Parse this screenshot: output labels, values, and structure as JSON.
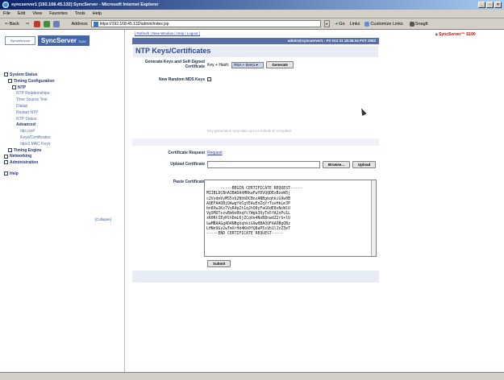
{
  "window": {
    "title": "syncserver1 [192.168.45.132] SyncServer - Microsoft Internet Explorer",
    "minimize": "_",
    "maximize": "▫",
    "close": "×"
  },
  "menubar": [
    "File",
    "Edit",
    "View",
    "Favorites",
    "Tools",
    "Help"
  ],
  "toolbar": {
    "back": "Back",
    "address_label": "Address",
    "address_value": "https://192.168.45.132/admin/index.jsp",
    "go": "Go",
    "links": "Links",
    "customize_links": "Customize Links",
    "snagit": "SnagIt"
  },
  "nav": {
    "logo_company": "Symmetricom",
    "logo_product": "SyncServer",
    "logo_model": "S100",
    "items": [
      {
        "label": "System Status",
        "level": 0,
        "bold": true
      },
      {
        "label": "Timing Configuration",
        "level": 1,
        "bold": true
      },
      {
        "label": "NTP",
        "level": 2,
        "bold": true
      },
      {
        "label": "NTP Relationships",
        "level": 3,
        "bold": false
      },
      {
        "label": "Time Source Test",
        "level": 3,
        "bold": false
      },
      {
        "label": "Dialup",
        "level": 3,
        "bold": false
      },
      {
        "label": "Restart NTP",
        "level": 3,
        "bold": false
      },
      {
        "label": "NTP Status",
        "level": 3,
        "bold": false
      },
      {
        "label": "Advanced",
        "level": 3,
        "bold": true
      },
      {
        "label": "ntp.conf",
        "level": 4,
        "bold": false
      },
      {
        "label": "Keys/Certificates",
        "level": 4,
        "bold": false
      },
      {
        "label": "ntpv3 MAC Keys",
        "level": 4,
        "bold": false
      },
      {
        "label": "Timing Engine",
        "level": 1,
        "bold": true
      },
      {
        "label": "Networking",
        "level": 0,
        "bold": true
      },
      {
        "label": "Administration",
        "level": 0,
        "bold": true
      },
      {
        "label": "Help",
        "level": 0,
        "bold": true
      }
    ],
    "collapse": "[Collapse]"
  },
  "main": {
    "toplinks": "[ Refresh | New Window | Help | Logout ]",
    "brand": "SyncServer™ S100",
    "userbar": "admin@syncserver1 - Fri Oct 31 18:36:34 PST 2003",
    "title": "NTP Keys/Certificates",
    "generate_label": "Generate Keys and Self-Signed Certificate",
    "key_hash_label": "Key + Hash:",
    "key_hash_value": "RSA + SHA1",
    "generate_button": "Generate",
    "new_md5_label": "New Random MD5 Keys",
    "note": "Key generation may take up to a minute to complete.",
    "cert_request_label": "Certificate Request",
    "cert_request_link": "Request",
    "upload_label": "Upload Certificate",
    "browse_button": "Browse...",
    "upload_button": "Upload",
    "paste_label": "Paste Certificate",
    "paste_value": "-----BEGIN CERTIFICATE REQUEST-----\nMIIBLDCBnAIBADAhMRkwFwYDVQQDExBzeW5j\nc2VydmVyMS5sb2NhbDCBnzANBgkqhkiG9w0B\nAQEFAAOBjQAwgYkCgYEAuEnZqYrTuvHkLm3P\nbn8Xw2Ks7VyR4pZt1qJhQ0yFaG6dE8xNcWlU\nVgSMUT+zvBm9oRhqYc7Wgk3XyTe5fA2nPu1L\nxK0RtIEyHlhDmL6jZCqVe4NoB8nwdZ2rS+lU\nGwMBAAGgADANBgkqhkiG9w0BAQQFAAOBgQBz\nLHNn9Gy2wTmXrHd4Kk0fQ8aP5sVb1lJcZ3eT\n-----END CERTIFICATE REQUEST-----",
    "submit_button": "Submit"
  }
}
